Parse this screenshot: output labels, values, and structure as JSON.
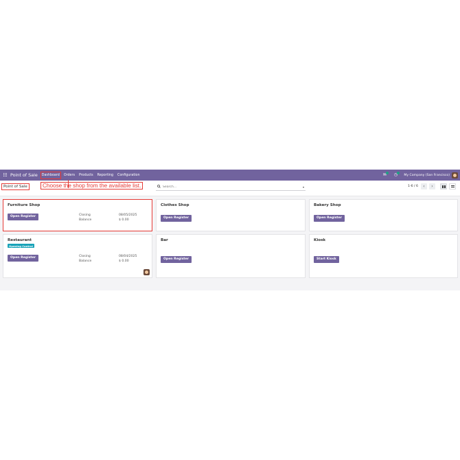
{
  "navbar": {
    "app_name": "Point of Sale",
    "menu": [
      "Dashboard",
      "Orders",
      "Products",
      "Reporting",
      "Configuration"
    ],
    "company": "My Company (San Francisco)",
    "icons": [
      "apps-grid-icon",
      "chat-icon",
      "activity-clock-icon",
      "user-avatar"
    ],
    "color": "#71639e"
  },
  "control": {
    "breadcrumb": "Point of Sale",
    "search_placeholder": "Search...",
    "pager": "1-6 / 6"
  },
  "annotation": {
    "text": "Choose the shop from the available list.",
    "color": "#e53935"
  },
  "cards": [
    {
      "title": "Furniture Shop",
      "button": "Open Register",
      "closing_label": "Closing",
      "closing_value": "08/05/2025",
      "balance_label": "Balance",
      "balance_value": "$ 0.00"
    },
    {
      "title": "Clothes Shop",
      "button": "Open Register"
    },
    {
      "title": "Bakery Shop",
      "button": "Open Register"
    },
    {
      "title": "Restaurant",
      "badge": "Opening Control",
      "button": "Open Register",
      "closing_label": "Closing",
      "closing_value": "08/04/2025",
      "balance_label": "Balance",
      "balance_value": "$ 0.00"
    },
    {
      "title": "Bar",
      "button": "Open Register"
    },
    {
      "title": "Kiosk",
      "button": "Start Kiosk"
    }
  ]
}
